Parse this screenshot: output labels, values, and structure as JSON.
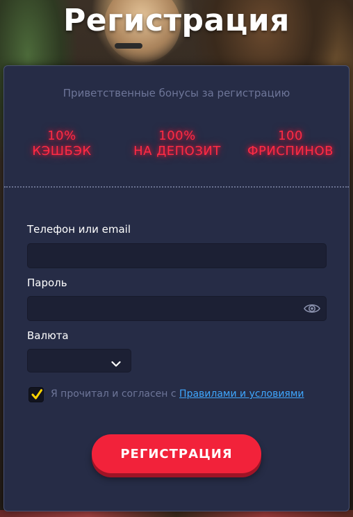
{
  "page": {
    "title": "Регистрация"
  },
  "bonuses": {
    "caption": "Приветственные бонусы за регистрацию",
    "items": [
      {
        "value": "10%",
        "label": "КЭШБЭК"
      },
      {
        "value": "100%",
        "label": "НА ДЕПОЗИТ"
      },
      {
        "value": "100",
        "label": "ФРИСПИНОВ"
      }
    ],
    "glow_color": "#ff2b45"
  },
  "form": {
    "login_label": "Телефон или email",
    "login_value": "",
    "password_label": "Пароль",
    "password_value": "",
    "currency_label": "Валюта",
    "currency_value": "",
    "terms_text": "Я прочитал и согласен с ",
    "terms_link": "Правилами и условиями",
    "terms_checked": true,
    "submit_label": "РЕГИСТРАЦИЯ"
  },
  "colors": {
    "card_bg": "#262c46",
    "accent": "#f2223a",
    "link": "#3fa7ff",
    "check": "#ffd400"
  },
  "icons": [
    "eye-icon",
    "chevron-down-icon",
    "check-icon"
  ]
}
